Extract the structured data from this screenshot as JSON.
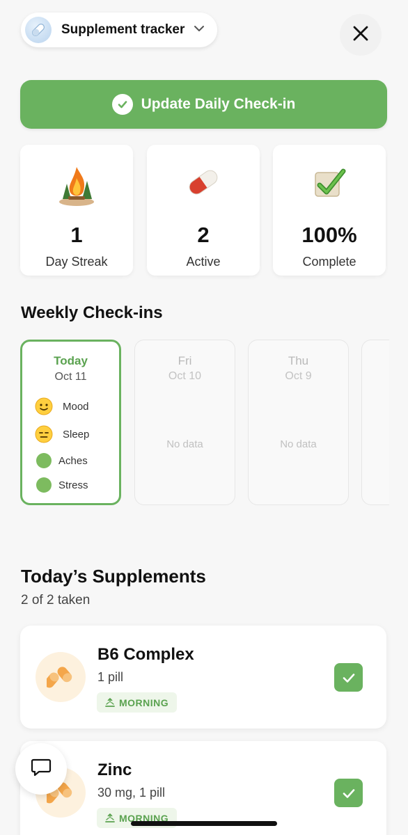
{
  "header": {
    "tracker_title": "Supplement tracker",
    "avatar_icon": "pill-capsule-icon",
    "chevron_icon": "chevron-down-icon",
    "close_icon": "close-icon"
  },
  "cta": {
    "label": "Update Daily Check-in",
    "icon": "check-circle-icon",
    "color": "#6ab25f"
  },
  "stats": [
    {
      "icon": "campfire-icon",
      "value": "1",
      "label": "Day Streak"
    },
    {
      "icon": "pill-icon",
      "value": "2",
      "label": "Active"
    },
    {
      "icon": "check-box-icon",
      "value": "100%",
      "label": "Complete"
    }
  ],
  "weekly": {
    "title": "Weekly Check-ins",
    "days": [
      {
        "name": "Today",
        "date": "Oct 11",
        "selected": true,
        "metrics": [
          {
            "icon": "smile-face-icon",
            "label": "Mood"
          },
          {
            "icon": "neutral-face-icon",
            "label": "Sleep"
          },
          {
            "icon": "green-dot-icon",
            "label": "Aches"
          },
          {
            "icon": "green-dot-icon",
            "label": "Stress"
          }
        ]
      },
      {
        "name": "Fri",
        "date": "Oct 10",
        "status": "No data"
      },
      {
        "name": "Thu",
        "date": "Oct 9",
        "status": "No data"
      }
    ]
  },
  "supplements": {
    "title": "Today’s Supplements",
    "subtitle": "2 of 2 taken",
    "items": [
      {
        "name": "B6 Complex",
        "dose": "1 pill",
        "time": "MORNING",
        "taken": true
      },
      {
        "name": "Zinc",
        "dose": "30 mg, 1 pill",
        "time": "MORNING",
        "taken": true
      }
    ]
  },
  "floating": {
    "chat_icon": "chat-bubble-icon"
  },
  "colors": {
    "accent": "#6ab25f",
    "tag_bg": "#eef6ea",
    "icon_bg": "#fdf1de"
  }
}
